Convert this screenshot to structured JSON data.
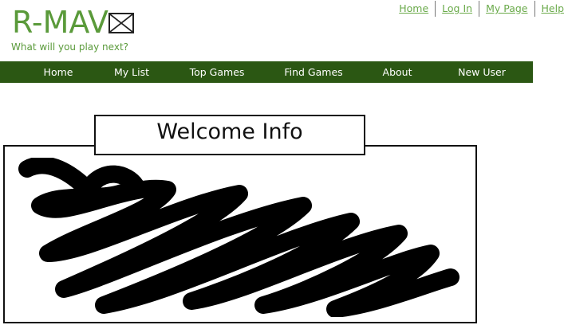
{
  "header": {
    "logo_text": "R-MAV",
    "tagline": "What will you play next?"
  },
  "top_links": [
    "Home",
    "Log In",
    "My Page",
    "Help"
  ],
  "nav": [
    "Home",
    "My List",
    "Top Games",
    "Find Games",
    "About",
    "New User"
  ],
  "content": {
    "panel_title": "Welcome Info"
  },
  "colors": {
    "brand_green": "#5a9a3a",
    "nav_bg": "#2b5713",
    "link_green": "#6aaa4a"
  },
  "icons": {
    "logo_placeholder": "image-placeholder-icon"
  }
}
